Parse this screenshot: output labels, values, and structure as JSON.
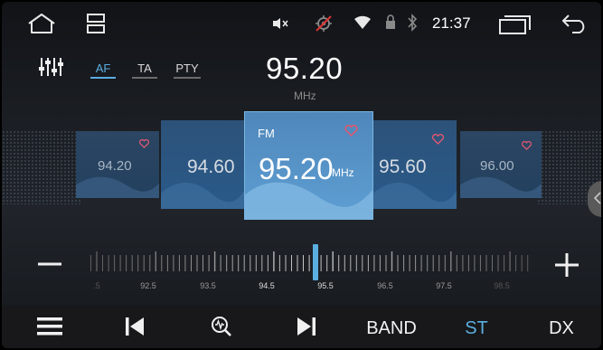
{
  "status_bar": {
    "time": "21:37",
    "icons": [
      "home-icon",
      "window-switcher-icon",
      "volume-mute-icon",
      "gps-off-icon",
      "wifi-icon",
      "lock-icon",
      "bluetooth-icon",
      "recent-apps-icon",
      "back-icon"
    ]
  },
  "options": {
    "eq_icon": "equalizer-icon",
    "tabs": [
      {
        "label": "AF",
        "active": true
      },
      {
        "label": "TA",
        "active": false
      },
      {
        "label": "PTY",
        "active": false
      }
    ]
  },
  "tuner": {
    "frequency": "95.20",
    "unit": "MHz"
  },
  "presets": [
    {
      "freq": "94.20",
      "favorite": true
    },
    {
      "freq": "94.60",
      "favorite": false
    },
    {
      "freq": "95.20",
      "band": "FM",
      "unit": "MHz",
      "favorite": true,
      "current": true
    },
    {
      "freq": "95.60",
      "favorite": true
    },
    {
      "freq": "96.00",
      "favorite": true
    }
  ],
  "scale": {
    "minus_label": "−",
    "plus_label": "+",
    "ticks": [
      ".5",
      "92.5",
      "93.5",
      "94.5",
      "95.5",
      "96.5",
      "97.5",
      "98.5"
    ],
    "position_mhz": 95.2,
    "range_mhz": [
      91.5,
      99.3
    ]
  },
  "bottom_nav": {
    "items": [
      {
        "name": "menu",
        "icon": "menu-icon"
      },
      {
        "name": "prev",
        "icon": "skip-previous-icon"
      },
      {
        "name": "scan",
        "icon": "search-scan-icon"
      },
      {
        "name": "next",
        "icon": "skip-next-icon"
      },
      {
        "name": "band",
        "label": "BAND"
      },
      {
        "name": "stereo",
        "label": "ST",
        "active": true
      },
      {
        "name": "dx",
        "label": "DX"
      }
    ]
  },
  "colors": {
    "accent": "#5aaee0",
    "card_active": "#5e9fd3",
    "card_inactive": "#2a5a8a",
    "favorite": "#e05870"
  }
}
